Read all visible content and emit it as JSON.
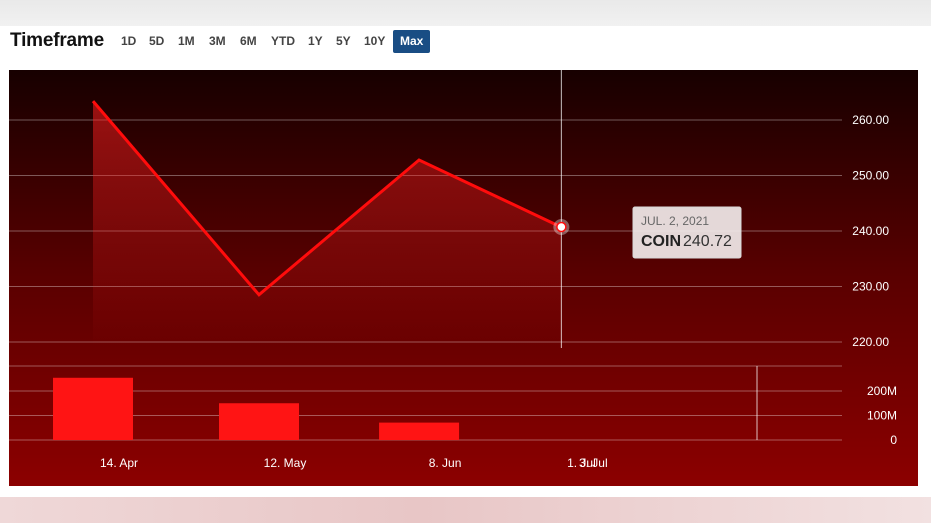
{
  "toolbar": {
    "title": "Timeframe",
    "ranges": [
      "1D",
      "5D",
      "1M",
      "3M",
      "6M",
      "YTD",
      "1Y",
      "5Y",
      "10Y",
      "Max"
    ],
    "active_range": "Max",
    "active_color": "#194d84"
  },
  "colors": {
    "background_top": "#170000",
    "background_bottom": "#8c0000",
    "line": "#ff0c0c",
    "volume_bar": "#ff1414",
    "axis_text": "#ffffff"
  },
  "chart_data": {
    "type": "line",
    "ticker": "COIN",
    "x_labels": [
      "14. Apr",
      "12. May",
      "8. Jun",
      "1. Jul",
      "3. Jul"
    ],
    "price": {
      "x": [
        "14. Apr",
        "12. May",
        "8. Jun",
        "1. Jul",
        "2. Jul"
      ],
      "values": [
        263.4,
        228.5,
        252.8,
        241.2,
        240.72
      ]
    },
    "y_ticks": [
      "260.00",
      "250.00",
      "240.00",
      "230.00",
      "220.00"
    ],
    "ylim": [
      220,
      270
    ],
    "volume": {
      "x": [
        "14. Apr",
        "12. May",
        "8. Jun"
      ],
      "values": [
        254,
        150,
        71
      ]
    },
    "volume_ticks": [
      "200M",
      "100M",
      "0"
    ],
    "volume_ylim": [
      0,
      300
    ],
    "grid": true,
    "tooltip": {
      "date": "JUL. 2, 2021",
      "series": "COIN",
      "value": "240.72"
    }
  }
}
